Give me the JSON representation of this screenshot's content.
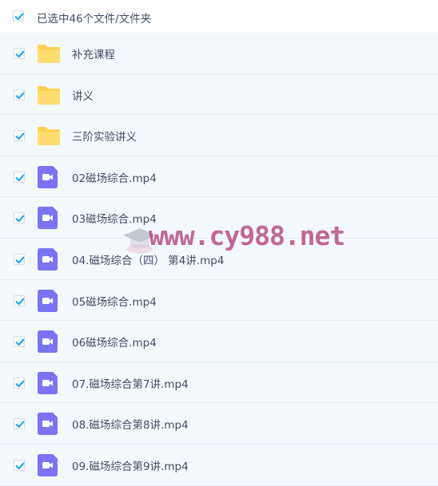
{
  "header": {
    "selected_text": "已选中46个文件/文件夹",
    "checked": true
  },
  "colors": {
    "check_blue": "#06a7ff",
    "folder_yellow": "#ffd150",
    "video_purple": "#7b73f5",
    "row_background": "#f4f9fd",
    "text": "#424e67",
    "watermark": "#b0306e"
  },
  "items": [
    {
      "name": "补充课程",
      "type": "folder",
      "icon": "folder-icon",
      "checked": true
    },
    {
      "name": "讲义",
      "type": "folder",
      "icon": "folder-icon",
      "checked": true
    },
    {
      "name": "三阶实验讲义",
      "type": "folder",
      "icon": "folder-icon",
      "checked": true
    },
    {
      "name": "02磁场综合.mp4",
      "type": "video",
      "icon": "video-file-icon",
      "checked": true
    },
    {
      "name": "03磁场综合.mp4",
      "type": "video",
      "icon": "video-file-icon",
      "checked": true
    },
    {
      "name": "04.磁场综合（四） 第4讲.mp4",
      "type": "video",
      "icon": "video-file-icon",
      "checked": true
    },
    {
      "name": "05磁场综合.mp4",
      "type": "video",
      "icon": "video-file-icon",
      "checked": true
    },
    {
      "name": "06磁场综合.mp4",
      "type": "video",
      "icon": "video-file-icon",
      "checked": true
    },
    {
      "name": "07.磁场综合第7讲.mp4",
      "type": "video",
      "icon": "video-file-icon",
      "checked": true
    },
    {
      "name": "08.磁场综合第8讲.mp4",
      "type": "video",
      "icon": "video-file-icon",
      "checked": true
    },
    {
      "name": "09.磁场综合第9讲.mp4",
      "type": "video",
      "icon": "video-file-icon",
      "checked": true
    }
  ],
  "watermark": {
    "text": "www.cy988.net"
  }
}
